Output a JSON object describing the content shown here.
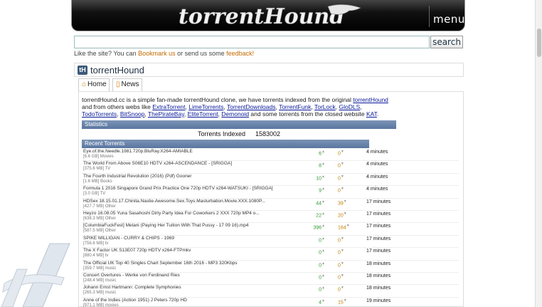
{
  "banner": {
    "logo_text": "torrentHound",
    "menu_label": "menu"
  },
  "search": {
    "placeholder": "",
    "button_label": "search"
  },
  "note": {
    "prefix": "Like the site? You can ",
    "bookmark_link": "Bookmark us",
    "middle": " or send us some ",
    "feedback_link": "feedback!"
  },
  "title_bar": {
    "icon_text": "tH",
    "title": "torrentHound"
  },
  "tabs": [
    {
      "label": "Home"
    },
    {
      "label": "News"
    }
  ],
  "intro": {
    "part1": "torrentHound.cc is a simple fan-made torrentHound clone, we have torrents indexed from the original ",
    "link_original": "torrentHound",
    "part2": " and from others webs like ",
    "links": [
      "ExtraTorrent",
      "LimeTorrents",
      "TorrentDownloads",
      "TorrentFunk",
      "TorLock",
      "GloDLS",
      "TodoTorrents",
      "BitSnoop",
      "ThePirateBay",
      "EliteTorrent",
      "Demonoid"
    ],
    "part3": " and some torrents from the closed website ",
    "link_kat": "KAT",
    "part4": "."
  },
  "stats": {
    "header": "Statistics",
    "label": "Torrents Indexed",
    "value": "1583002"
  },
  "recent": {
    "header": "Recent Torrents",
    "rows": [
      {
        "name": "Eye.of.the.Needle.1981.720p.BluRay.X264-AMIABLE",
        "size": "[6.6 GB]",
        "category": "Movies",
        "seeds": "6",
        "leech": "0",
        "age": "4 minutes"
      },
      {
        "name": "The World From Above S06E10 HDTV x264-ASCENDANCE - [SRIGGA]",
        "size": "[375.6 MB]",
        "category": "TV",
        "seeds": "8",
        "leech": "0",
        "age": "4 minutes"
      },
      {
        "name": "The Fourth Industrial Revolution (2016) (Pdf) Gooner",
        "size": "[1.6 MB]",
        "category": "Books",
        "seeds": "10",
        "leech": "0",
        "age": "4 minutes"
      },
      {
        "name": "Formula 1 2016 Singapore Grand Prix Practice One 720p HDTV x264-WATSUKI - [SRIGGA]",
        "size": "[3.0 GB]",
        "category": "TV",
        "seeds": "9",
        "leech": "0",
        "age": "4 minutes"
      },
      {
        "name": "HDSex 18.15.01.17.Chinita.Nastie.Awesome.Sex.Toys.Masturbation.Movie.XXX.1080P...",
        "size": "[427.7 MB]",
        "category": "Other",
        "seeds": "44",
        "leech": "39",
        "age": "17 minutes"
      },
      {
        "name": "Heyzo 16.08.05 Yuna Sasahoshi Dirty Party Idea For Coworkers 2 XXX 720p MP4 o...",
        "size": "[638.3 MB]",
        "category": "Other",
        "seeds": "22",
        "leech": "20",
        "age": "17 minutes"
      },
      {
        "name": "[ColumbiaFuckFest] Melani (Paying Her Tuition With That Pussy - 17 09 16).mp4",
        "size": "[587.5 MB]",
        "category": "Other",
        "seeds": "396",
        "leech": "164",
        "age": "17 minutes"
      },
      {
        "name": "SPIKE MILLIGAN - CURRY & CHIPS - 1969",
        "size": "[756.8 MB]",
        "category": "tv",
        "seeds": "0",
        "leech": "0",
        "age": "17 minutes"
      },
      {
        "name": "The X Factor UK S13E07 720p HDTV x264-FTPmkv",
        "size": "[880.4 MB]",
        "category": "tv",
        "seeds": "0",
        "leech": "0",
        "age": "17 minutes"
      },
      {
        "name": "The Official UK Top 40 Singles Chart September 16th 2016 - MP3 320Kbps",
        "size": "[359.7 MB]",
        "category": "music",
        "seeds": "0",
        "leech": "0",
        "age": "18 minutes"
      },
      {
        "name": "Concert Overtures - Werke von Ferdinand Ries",
        "size": "[248.4 MB]",
        "category": "music",
        "seeds": "0",
        "leech": "0",
        "age": "18 minutes"
      },
      {
        "name": "Johann Ernst Hartmann: Complete Symphonies",
        "size": "[265.3 MB]",
        "category": "music",
        "seeds": "0",
        "leech": "0",
        "age": "18 minutes"
      },
      {
        "name": "Anne of the Indies (Action 1951) J Peters 720p HD",
        "size": "[971.1 MB]",
        "category": "movies",
        "seeds": "4",
        "leech": "15",
        "age": "19 minutes"
      }
    ]
  }
}
